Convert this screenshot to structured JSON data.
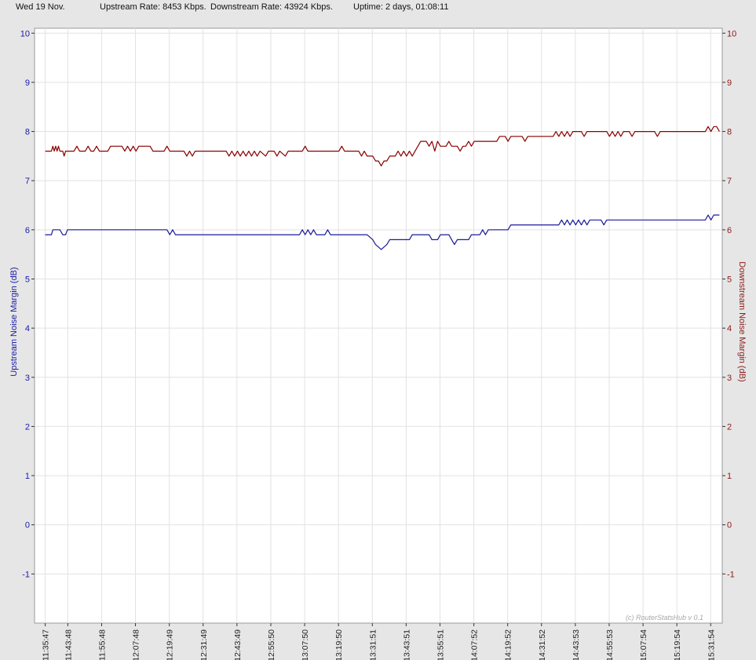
{
  "status": {
    "date": "Wed 19 Nov.",
    "upstream_rate": "Upstream Rate: 8453 Kbps.",
    "downstream_rate": "Downstream Rate: 43924 Kbps.",
    "uptime": "Uptime: 2 days, 01:08:11"
  },
  "colors": {
    "upstream": "#1a1a9a",
    "downstream": "#8b0000",
    "grid": "#e2e2e2",
    "plot_background": "#ffffff",
    "page_background": "#e6e6e6"
  },
  "chart_data": {
    "type": "line",
    "title": "",
    "grid": true,
    "watermark": "(c) RouterStatsHub v 0.1",
    "y_left": {
      "label": "Upstream Noise Margin (dB)",
      "ylim": [
        -2,
        10.1
      ],
      "ticks": [
        "10",
        "9",
        "8",
        "7",
        "6",
        "5",
        "4",
        "3",
        "2",
        "1",
        "0",
        "-1"
      ]
    },
    "y_right": {
      "label": "Downstream Noise Margin (dB)",
      "ylim": [
        -2,
        10.1
      ],
      "ticks": [
        "10",
        "9",
        "8",
        "7",
        "6",
        "5",
        "4",
        "3",
        "2",
        "1",
        "0",
        "-1"
      ]
    },
    "x": {
      "range": [
        "11:32:00",
        "15:36:00"
      ],
      "ticks": [
        "11:35:47",
        "11:43:48",
        "11:55:48",
        "12:07:48",
        "12:19:49",
        "12:31:49",
        "12:43:49",
        "12:55:50",
        "13:07:50",
        "13:19:50",
        "13:31:51",
        "13:43:51",
        "13:55:51",
        "14:07:52",
        "14:19:52",
        "14:31:52",
        "14:43:53",
        "14:55:53",
        "15:07:54",
        "15:19:54",
        "15:31:54"
      ]
    },
    "series": [
      {
        "axis": "left",
        "points": [
          [
            "11:35:47",
            5.9
          ],
          [
            "11:38:00",
            5.9
          ],
          [
            "11:38:30",
            6.0
          ],
          [
            "11:41:00",
            6.0
          ],
          [
            "11:42:00",
            5.9
          ],
          [
            "11:43:00",
            5.9
          ],
          [
            "11:43:40",
            6.0
          ],
          [
            "12:14:00",
            6.0
          ],
          [
            "12:19:00",
            6.0
          ],
          [
            "12:20:00",
            5.9
          ],
          [
            "12:21:00",
            6.0
          ],
          [
            "12:22:00",
            5.9
          ],
          [
            "13:04:00",
            5.9
          ],
          [
            "13:06:00",
            5.9
          ],
          [
            "13:07:00",
            6.0
          ],
          [
            "13:08:00",
            5.9
          ],
          [
            "13:09:00",
            6.0
          ],
          [
            "13:10:00",
            5.9
          ],
          [
            "13:11:00",
            6.0
          ],
          [
            "13:12:00",
            5.9
          ],
          [
            "13:15:00",
            5.9
          ],
          [
            "13:16:00",
            6.0
          ],
          [
            "13:17:00",
            5.9
          ],
          [
            "13:30:00",
            5.9
          ],
          [
            "13:32:00",
            5.8
          ],
          [
            "13:33:00",
            5.7
          ],
          [
            "13:35:00",
            5.6
          ],
          [
            "13:37:00",
            5.7
          ],
          [
            "13:38:00",
            5.8
          ],
          [
            "13:45:00",
            5.8
          ],
          [
            "13:46:00",
            5.9
          ],
          [
            "13:52:00",
            5.9
          ],
          [
            "13:53:00",
            5.8
          ],
          [
            "13:55:00",
            5.8
          ],
          [
            "13:56:00",
            5.9
          ],
          [
            "13:59:00",
            5.9
          ],
          [
            "14:00:00",
            5.8
          ],
          [
            "14:01:00",
            5.7
          ],
          [
            "14:02:00",
            5.8
          ],
          [
            "14:06:00",
            5.8
          ],
          [
            "14:07:00",
            5.9
          ],
          [
            "14:10:00",
            5.9
          ],
          [
            "14:11:00",
            6.0
          ],
          [
            "14:12:00",
            5.9
          ],
          [
            "14:13:00",
            6.0
          ],
          [
            "14:20:00",
            6.0
          ],
          [
            "14:21:00",
            6.1
          ],
          [
            "14:38:00",
            6.1
          ],
          [
            "14:39:00",
            6.2
          ],
          [
            "14:40:00",
            6.1
          ],
          [
            "14:41:00",
            6.2
          ],
          [
            "14:42:00",
            6.1
          ],
          [
            "14:43:00",
            6.2
          ],
          [
            "14:44:00",
            6.1
          ],
          [
            "14:45:00",
            6.2
          ],
          [
            "14:46:00",
            6.1
          ],
          [
            "14:47:00",
            6.2
          ],
          [
            "14:48:00",
            6.1
          ],
          [
            "14:49:00",
            6.2
          ],
          [
            "14:53:00",
            6.2
          ],
          [
            "14:54:00",
            6.1
          ],
          [
            "14:55:00",
            6.2
          ],
          [
            "15:30:00",
            6.2
          ],
          [
            "15:31:00",
            6.3
          ],
          [
            "15:32:00",
            6.2
          ],
          [
            "15:33:00",
            6.3
          ],
          [
            "15:35:00",
            6.3
          ]
        ]
      },
      {
        "axis": "right",
        "points": [
          [
            "11:35:47",
            7.6
          ],
          [
            "11:38:00",
            7.6
          ],
          [
            "11:38:30",
            7.7
          ],
          [
            "11:39:00",
            7.6
          ],
          [
            "11:39:30",
            7.7
          ],
          [
            "11:40:00",
            7.6
          ],
          [
            "11:40:30",
            7.7
          ],
          [
            "11:41:00",
            7.6
          ],
          [
            "11:42:00",
            7.6
          ],
          [
            "11:42:30",
            7.5
          ],
          [
            "11:43:00",
            7.6
          ],
          [
            "11:46:00",
            7.6
          ],
          [
            "11:47:00",
            7.7
          ],
          [
            "11:48:00",
            7.6
          ],
          [
            "11:50:00",
            7.6
          ],
          [
            "11:51:00",
            7.7
          ],
          [
            "11:52:00",
            7.6
          ],
          [
            "11:53:00",
            7.6
          ],
          [
            "11:54:00",
            7.7
          ],
          [
            "11:55:00",
            7.6
          ],
          [
            "11:58:00",
            7.6
          ],
          [
            "11:59:00",
            7.7
          ],
          [
            "12:03:00",
            7.7
          ],
          [
            "12:04:00",
            7.6
          ],
          [
            "12:05:00",
            7.7
          ],
          [
            "12:06:00",
            7.6
          ],
          [
            "12:07:00",
            7.7
          ],
          [
            "12:08:00",
            7.6
          ],
          [
            "12:09:00",
            7.7
          ],
          [
            "12:13:00",
            7.7
          ],
          [
            "12:14:00",
            7.6
          ],
          [
            "12:18:00",
            7.6
          ],
          [
            "12:19:00",
            7.7
          ],
          [
            "12:20:00",
            7.6
          ],
          [
            "12:25:00",
            7.6
          ],
          [
            "12:26:00",
            7.5
          ],
          [
            "12:27:00",
            7.6
          ],
          [
            "12:28:00",
            7.5
          ],
          [
            "12:29:00",
            7.6
          ],
          [
            "12:40:00",
            7.6
          ],
          [
            "12:41:00",
            7.5
          ],
          [
            "12:42:00",
            7.6
          ],
          [
            "12:43:00",
            7.5
          ],
          [
            "12:44:00",
            7.6
          ],
          [
            "12:45:00",
            7.5
          ],
          [
            "12:46:00",
            7.6
          ],
          [
            "12:47:00",
            7.5
          ],
          [
            "12:48:00",
            7.6
          ],
          [
            "12:49:00",
            7.5
          ],
          [
            "12:50:00",
            7.6
          ],
          [
            "12:51:00",
            7.5
          ],
          [
            "12:52:00",
            7.6
          ],
          [
            "12:54:00",
            7.5
          ],
          [
            "12:55:00",
            7.6
          ],
          [
            "12:57:00",
            7.6
          ],
          [
            "12:58:00",
            7.5
          ],
          [
            "12:59:00",
            7.6
          ],
          [
            "13:01:00",
            7.5
          ],
          [
            "13:02:00",
            7.6
          ],
          [
            "13:07:00",
            7.6
          ],
          [
            "13:08:00",
            7.7
          ],
          [
            "13:09:00",
            7.6
          ],
          [
            "13:20:00",
            7.6
          ],
          [
            "13:21:00",
            7.7
          ],
          [
            "13:22:00",
            7.6
          ],
          [
            "13:27:00",
            7.6
          ],
          [
            "13:28:00",
            7.5
          ],
          [
            "13:29:00",
            7.6
          ],
          [
            "13:30:00",
            7.5
          ],
          [
            "13:32:00",
            7.5
          ],
          [
            "13:33:00",
            7.4
          ],
          [
            "13:34:00",
            7.4
          ],
          [
            "13:35:00",
            7.3
          ],
          [
            "13:36:00",
            7.4
          ],
          [
            "13:37:00",
            7.4
          ],
          [
            "13:38:00",
            7.5
          ],
          [
            "13:40:00",
            7.5
          ],
          [
            "13:41:00",
            7.6
          ],
          [
            "13:42:00",
            7.5
          ],
          [
            "13:43:00",
            7.6
          ],
          [
            "13:44:00",
            7.5
          ],
          [
            "13:45:00",
            7.6
          ],
          [
            "13:46:00",
            7.5
          ],
          [
            "13:47:00",
            7.6
          ],
          [
            "13:48:00",
            7.7
          ],
          [
            "13:49:00",
            7.8
          ],
          [
            "13:51:00",
            7.8
          ],
          [
            "13:52:00",
            7.7
          ],
          [
            "13:53:00",
            7.8
          ],
          [
            "13:54:00",
            7.6
          ],
          [
            "13:55:00",
            7.8
          ],
          [
            "13:56:00",
            7.7
          ],
          [
            "13:58:00",
            7.7
          ],
          [
            "13:59:00",
            7.8
          ],
          [
            "14:00:00",
            7.7
          ],
          [
            "14:02:00",
            7.7
          ],
          [
            "14:03:00",
            7.6
          ],
          [
            "14:04:00",
            7.7
          ],
          [
            "14:05:00",
            7.7
          ],
          [
            "14:06:00",
            7.8
          ],
          [
            "14:07:00",
            7.7
          ],
          [
            "14:08:00",
            7.8
          ],
          [
            "14:16:00",
            7.8
          ],
          [
            "14:17:00",
            7.9
          ],
          [
            "14:19:00",
            7.9
          ],
          [
            "14:20:00",
            7.8
          ],
          [
            "14:21:00",
            7.9
          ],
          [
            "14:25:00",
            7.9
          ],
          [
            "14:26:00",
            7.8
          ],
          [
            "14:27:00",
            7.9
          ],
          [
            "14:36:00",
            7.9
          ],
          [
            "14:37:00",
            8.0
          ],
          [
            "14:38:00",
            7.9
          ],
          [
            "14:39:00",
            8.0
          ],
          [
            "14:40:00",
            7.9
          ],
          [
            "14:41:00",
            8.0
          ],
          [
            "14:42:00",
            7.9
          ],
          [
            "14:43:00",
            8.0
          ],
          [
            "14:46:00",
            8.0
          ],
          [
            "14:47:00",
            7.9
          ],
          [
            "14:48:00",
            8.0
          ],
          [
            "14:55:00",
            8.0
          ],
          [
            "14:56:00",
            7.9
          ],
          [
            "14:57:00",
            8.0
          ],
          [
            "14:58:00",
            7.9
          ],
          [
            "14:59:00",
            8.0
          ],
          [
            "15:00:00",
            7.9
          ],
          [
            "15:01:00",
            8.0
          ],
          [
            "15:03:00",
            8.0
          ],
          [
            "15:04:00",
            7.9
          ],
          [
            "15:05:00",
            8.0
          ],
          [
            "15:12:00",
            8.0
          ],
          [
            "15:13:00",
            7.9
          ],
          [
            "15:14:00",
            8.0
          ],
          [
            "15:30:00",
            8.0
          ],
          [
            "15:31:00",
            8.1
          ],
          [
            "15:32:00",
            8.0
          ],
          [
            "15:33:00",
            8.1
          ],
          [
            "15:34:00",
            8.1
          ],
          [
            "15:35:00",
            8.0
          ]
        ]
      }
    ]
  }
}
